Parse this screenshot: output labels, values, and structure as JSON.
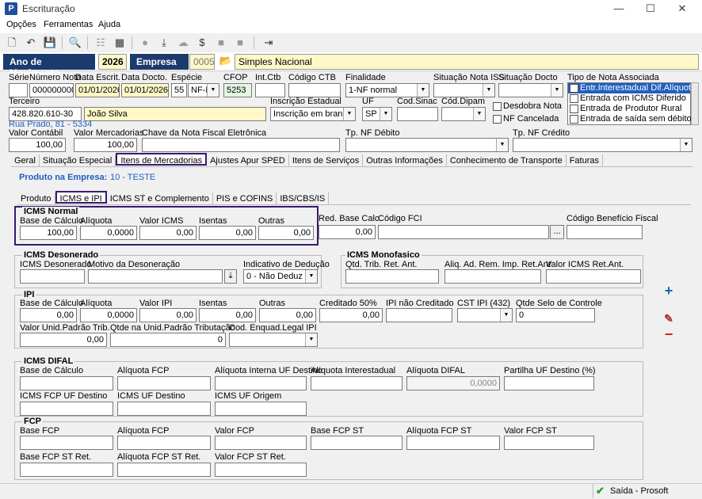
{
  "window": {
    "title": "Escrituração",
    "min": "—",
    "max": "☐",
    "close": "✕"
  },
  "menu": [
    "Opções",
    "Ferramentas",
    "Ajuda"
  ],
  "year": {
    "label": "Ano de Movimento",
    "value": "2026"
  },
  "empresa": {
    "label": "Empresa",
    "code": "0005",
    "name": "Simples Nacional"
  },
  "header": {
    "serie": {
      "label": "Série",
      "value": ""
    },
    "numero": {
      "label": "Número Nota",
      "value": "0000000001"
    },
    "dataEscrit": {
      "label": "Data Escrit.",
      "value": "01/01/2026"
    },
    "dataDocto": {
      "label": "Data Docto.",
      "value": "01/01/2026"
    },
    "especie": {
      "label": "Espécie",
      "value": "55",
      "sub": "NF-E"
    },
    "cfop": {
      "label": "CFOP",
      "value": "5253"
    },
    "intCtb": {
      "label": "Int.Ctb",
      "value": ""
    },
    "codCtb": {
      "label": "Código CTB",
      "value": ""
    },
    "finalidade": {
      "label": "Finalidade",
      "value": "1-NF normal"
    },
    "sitIss": {
      "label": "Situação Nota ISS",
      "value": ""
    },
    "sitDocto": {
      "label": "Situação Docto",
      "value": ""
    },
    "tipoNota": {
      "label": "Tipo de Nota Associada",
      "items": [
        "Entr.Interestadual Dif.Alíquota",
        "Entrada com ICMS Diferido",
        "Entrada de Produtor Rural",
        "Entrada de saída sem débito"
      ]
    },
    "terceiro": {
      "label": "Terceiro",
      "cnpj": "428.820.610-30",
      "name": "João Silva",
      "address": "Rua Prado, 81 - 5334"
    },
    "inscEst": {
      "label": "Inscrição Estadual",
      "value": "Inscrição em branco"
    },
    "uf": {
      "label": "UF",
      "value": "SP"
    },
    "codSinac": {
      "label": "Cod.Sinac",
      "value": ""
    },
    "codDipam": {
      "label": "Cód.Dipam",
      "value": ""
    },
    "desdobra": "Desdobra Nota",
    "cancelada": "NF Cancelada",
    "valorContabil": {
      "label": "Valor Contábil",
      "value": "100,00"
    },
    "valorMerc": {
      "label": "Valor Mercadorias",
      "value": "100,00"
    },
    "chave": {
      "label": "Chave da Nota Fiscal Eletrônica",
      "value": ""
    },
    "tpDebito": {
      "label": "Tp. NF Débito",
      "value": ""
    },
    "tpCredito": {
      "label": "Tp. NF Crédito",
      "value": ""
    }
  },
  "tabs": [
    "Geral",
    "Situação Especial",
    "Itens de Mercadorias",
    "Ajustes Apur SPED",
    "Itens de Serviços",
    "Outras Informações",
    "Conhecimento de Transporte",
    "Faturas"
  ],
  "produto": {
    "label": "Produto na Empresa:",
    "value": "10 - TESTE"
  },
  "subtabs": [
    "Produto",
    "ICMS e IPI",
    "ICMS ST e Complemento",
    "PIS e COFINS",
    "IBS/CBS/IS"
  ],
  "icmsNormal": {
    "title": "ICMS Normal",
    "fields": [
      {
        "label": "Base de Cálculo",
        "value": "100,00"
      },
      {
        "label": "Alíquota",
        "value": "0,0000"
      },
      {
        "label": "Valor ICMS",
        "value": "0,00"
      },
      {
        "label": "Isentas",
        "value": "0,00"
      },
      {
        "label": "Outras",
        "value": "0,00"
      }
    ],
    "redBase": {
      "label": "Red. Base Calc.",
      "value": "0,00"
    },
    "fci": {
      "label": "Código FCI",
      "value": "",
      "btn": "..."
    },
    "beneficio": {
      "label": "Código Benefício Fiscal",
      "value": ""
    }
  },
  "icmsDesonerado": {
    "title": "ICMS Desonerado",
    "valor": "ICMS Desonerado",
    "motivo": "Motivo da Desoneração",
    "indicativo": "Indicativo de Dedução",
    "indValue": "0 - Não Deduz"
  },
  "icmsMono": {
    "title": "ICMS Monofasico",
    "qtd": "Qtd. Trib. Ret. Ant.",
    "aliq": "Aliq. Ad. Rem. Imp. Ret.Ant",
    "valor": "Valor ICMS Ret.Ant."
  },
  "ipi": {
    "title": "IPI",
    "fields": [
      {
        "label": "Base de Cálculo",
        "value": "0,00"
      },
      {
        "label": "Alíquota",
        "value": "0,0000"
      },
      {
        "label": "Valor IPI",
        "value": "0,00"
      },
      {
        "label": "Isentas",
        "value": "0,00"
      },
      {
        "label": "Outras",
        "value": "0,00"
      },
      {
        "label": "Creditado 50%",
        "value": "0,00"
      }
    ],
    "naoCred": {
      "label": "IPI não Creditado",
      "value": ""
    },
    "cst": {
      "label": "CST IPI (432)",
      "value": ""
    },
    "selo": {
      "label": "Qtde Selo de Controle",
      "value": "0"
    },
    "valorUnid": {
      "label": "Valor Unid.Padrão Trib.",
      "value": "0,00"
    },
    "qtdeUnid": {
      "label": "Qtde na Unid.Padrão Tributação",
      "value": "0"
    },
    "enquad": {
      "label": "Cod. Enquad.Legal IPI",
      "value": ""
    }
  },
  "difal": {
    "title": "ICMS DIFAL",
    "labels": [
      "Base de Cálculo",
      "Alíquota FCP",
      "Alíquota Interna UF Destino",
      "Alíquota Interestadual",
      "Alíquota DIFAL",
      "Partilha UF Destino (%)"
    ],
    "aliqDifal": "0,0000",
    "labels2": [
      "ICMS FCP UF Destino",
      "ICMS UF Destino",
      "ICMS UF Origem"
    ]
  },
  "fcp": {
    "title": "FCP",
    "labels": [
      "Base FCP",
      "Alíquota FCP",
      "Valor FCP",
      "Base FCP ST",
      "Alíquota FCP ST",
      "Valor FCP ST"
    ],
    "labels2": [
      "Base FCP ST Ret.",
      "Alíquota FCP ST Ret.",
      "Valor FCP ST Ret."
    ]
  },
  "side": {
    "add": "+",
    "edit": "✎",
    "remove": "−"
  },
  "status": {
    "text": "Saída - Prosoft"
  }
}
